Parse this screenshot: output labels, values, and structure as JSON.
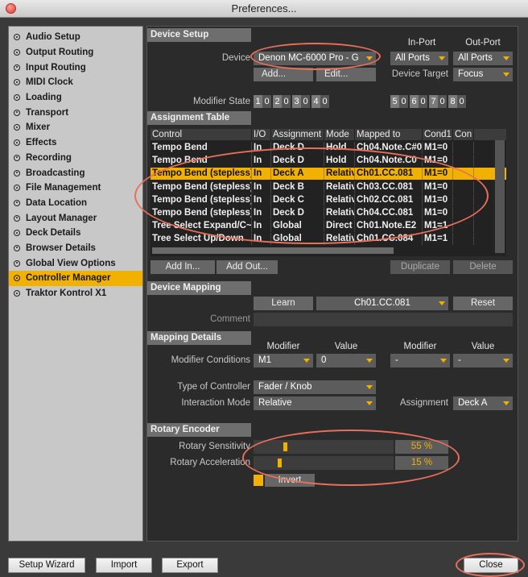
{
  "window": {
    "title": "Preferences..."
  },
  "sidebar": {
    "items": [
      {
        "label": "Audio Setup"
      },
      {
        "label": "Output Routing"
      },
      {
        "label": "Input Routing"
      },
      {
        "label": "MIDI Clock"
      },
      {
        "label": "Loading"
      },
      {
        "label": "Transport"
      },
      {
        "label": "Mixer"
      },
      {
        "label": "Effects"
      },
      {
        "label": "Recording"
      },
      {
        "label": "Broadcasting"
      },
      {
        "label": "File Management"
      },
      {
        "label": "Data Location"
      },
      {
        "label": "Layout Manager"
      },
      {
        "label": "Deck Details"
      },
      {
        "label": "Browser Details"
      },
      {
        "label": "Global View Options"
      },
      {
        "label": "Controller Manager",
        "active": true
      },
      {
        "label": "Traktor Kontrol X1"
      }
    ]
  },
  "device_setup": {
    "title": "Device Setup",
    "device_label": "Device",
    "device_value": "Denon MC-6000 Pro - G",
    "in_port_label": "In-Port",
    "out_port_label": "Out-Port",
    "in_port_value": "All Ports",
    "out_port_value": "All Ports",
    "add_label": "Add...",
    "edit_label": "Edit...",
    "device_target_label": "Device Target",
    "device_target_value": "Focus",
    "modifier_state_label": "Modifier State",
    "modifiers": [
      {
        "n": "1",
        "v": "0"
      },
      {
        "n": "2",
        "v": "0"
      },
      {
        "n": "3",
        "v": "0"
      },
      {
        "n": "4",
        "v": "0"
      },
      {
        "n": "5",
        "v": "0"
      },
      {
        "n": "6",
        "v": "0"
      },
      {
        "n": "7",
        "v": "0"
      },
      {
        "n": "8",
        "v": "0"
      }
    ]
  },
  "assignment_table": {
    "title": "Assignment Table",
    "columns": [
      "Control",
      "I/O",
      "Assignment",
      "Mode",
      "Mapped to",
      "Cond1",
      "Con"
    ],
    "rows": [
      {
        "cells": [
          "Tempo Bend",
          "In",
          "Deck D",
          "Hold",
          "Ch04.Note.C#0",
          "M1=0",
          ""
        ]
      },
      {
        "cells": [
          "Tempo Bend",
          "In",
          "Deck D",
          "Hold",
          "Ch04.Note.C0",
          "M1=0",
          ""
        ]
      },
      {
        "cells": [
          "Tempo Bend (stepless)",
          "In",
          "Deck A",
          "Relative",
          "Ch01.CC.081",
          "M1=0",
          ""
        ],
        "selected": true
      },
      {
        "cells": [
          "Tempo Bend (stepless)",
          "In",
          "Deck B",
          "Relative",
          "Ch03.CC.081",
          "M1=0",
          ""
        ]
      },
      {
        "cells": [
          "Tempo Bend (stepless)",
          "In",
          "Deck C",
          "Relative",
          "Ch02.CC.081",
          "M1=0",
          ""
        ]
      },
      {
        "cells": [
          "Tempo Bend (stepless)",
          "In",
          "Deck D",
          "Relative",
          "Ch04.CC.081",
          "M1=0",
          ""
        ]
      },
      {
        "cells": [
          "Tree Select Expand/C~",
          "In",
          "Global",
          "Direct",
          "Ch01.Note.E2",
          "M1=1",
          ""
        ]
      },
      {
        "cells": [
          "Tree Select Up/Down",
          "In",
          "Global",
          "Relative",
          "Ch01.CC.084",
          "M1=1",
          ""
        ]
      }
    ],
    "add_in_label": "Add In...",
    "add_out_label": "Add Out...",
    "duplicate_label": "Duplicate",
    "delete_label": "Delete"
  },
  "device_mapping": {
    "title": "Device Mapping",
    "learn_label": "Learn",
    "mapping_value": "Ch01.CC.081",
    "reset_label": "Reset",
    "comment_label": "Comment",
    "comment_value": ""
  },
  "mapping_details": {
    "title": "Mapping Details",
    "modifier_header": "Modifier",
    "value_header": "Value",
    "modifier_conditions_label": "Modifier Conditions",
    "cond1_modifier": "M1",
    "cond1_value": "0",
    "cond2_modifier": "-",
    "cond2_value": "-",
    "type_of_controller_label": "Type of Controller",
    "type_of_controller_value": "Fader / Knob",
    "interaction_mode_label": "Interaction Mode",
    "interaction_mode_value": "Relative",
    "assignment_label": "Assignment",
    "assignment_value": "Deck A"
  },
  "rotary_encoder": {
    "title": "Rotary Encoder",
    "sensitivity_label": "Rotary Sensitivity",
    "sensitivity_text": "55 %",
    "sensitivity_level": 0.1,
    "acceleration_label": "Rotary Acceleration",
    "acceleration_text": "15 %",
    "acceleration_level": 0.07,
    "invert_label": "Invert"
  },
  "bottom": {
    "setup_wizard_label": "Setup Wizard",
    "import_label": "Import",
    "export_label": "Export",
    "close_label": "Close"
  },
  "colors": {
    "accent": "#f2b000",
    "annotation": "#e8705a"
  }
}
